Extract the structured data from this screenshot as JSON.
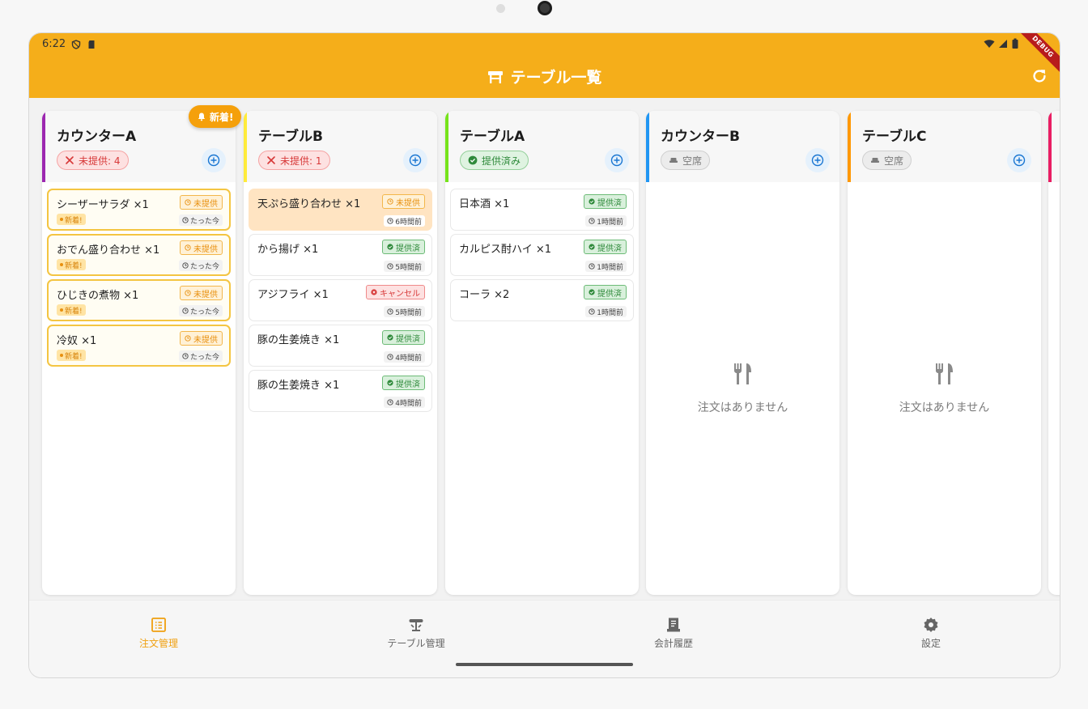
{
  "status_bar": {
    "time": "6:22",
    "debug_label": "DEBUG"
  },
  "app_bar": {
    "title": "テーブル一覧",
    "refresh_icon": "refresh-icon"
  },
  "columns": [
    {
      "name": "カウンターA",
      "accent": "#9c27b0",
      "status": "未提供: 4",
      "status_kind": "red",
      "new_badge": "新着!",
      "orders": [
        {
          "name": "シーザーサラダ ×1",
          "status": "未提供",
          "status_kind": "pending",
          "time": "たった今",
          "tag": "新着!"
        },
        {
          "name": "おでん盛り合わせ ×1",
          "status": "未提供",
          "status_kind": "pending",
          "time": "たった今",
          "tag": "新着!"
        },
        {
          "name": "ひじきの煮物 ×1",
          "status": "未提供",
          "status_kind": "pending",
          "time": "たった今",
          "tag": "新着!"
        },
        {
          "name": "冷奴 ×1",
          "status": "未提供",
          "status_kind": "pending",
          "time": "たった今",
          "tag": "新着!"
        }
      ]
    },
    {
      "name": "テーブルB",
      "accent": "#ffeb3b",
      "status": "未提供: 1",
      "status_kind": "red",
      "orders": [
        {
          "name": "天ぷら盛り合わせ ×1",
          "status": "未提供",
          "status_kind": "pending",
          "time": "6時間前",
          "highlight": true
        },
        {
          "name": "から揚げ ×1",
          "status": "提供済",
          "status_kind": "done",
          "time": "5時間前"
        },
        {
          "name": "アジフライ ×1",
          "status": "キャンセル",
          "status_kind": "cancel",
          "time": "5時間前"
        },
        {
          "name": "豚の生姜焼き ×1",
          "status": "提供済",
          "status_kind": "done",
          "time": "4時間前"
        },
        {
          "name": "豚の生姜焼き ×1",
          "status": "提供済",
          "status_kind": "done",
          "time": "4時間前"
        }
      ]
    },
    {
      "name": "テーブルA",
      "accent": "#76e31a",
      "status": "提供済み",
      "status_kind": "green",
      "orders": [
        {
          "name": "日本酒 ×1",
          "status": "提供済",
          "status_kind": "done",
          "time": "1時間前"
        },
        {
          "name": "カルピス酎ハイ ×1",
          "status": "提供済",
          "status_kind": "done",
          "time": "1時間前"
        },
        {
          "name": "コーラ ×2",
          "status": "提供済",
          "status_kind": "done",
          "time": "1時間前"
        }
      ]
    },
    {
      "name": "カウンターB",
      "accent": "#2196f3",
      "status": "空席",
      "status_kind": "gray",
      "orders": [],
      "empty_text": "注文はありません"
    },
    {
      "name": "テーブルC",
      "accent": "#ff9800",
      "status": "空席",
      "status_kind": "gray",
      "orders": [],
      "empty_text": "注文はありません"
    },
    {
      "name": "",
      "accent": "#e91e63",
      "status": "",
      "status_kind": "gray",
      "orders": []
    }
  ],
  "nav": [
    {
      "label": "注文管理",
      "icon": "order-list-icon",
      "active": true
    },
    {
      "label": "テーブル管理",
      "icon": "table-icon",
      "active": false
    },
    {
      "label": "会計履歴",
      "icon": "receipt-icon",
      "active": false
    },
    {
      "label": "設定",
      "icon": "gear-icon",
      "active": false
    }
  ],
  "colors": {
    "app_bar": "#f5ae1a",
    "active_nav": "#f0a010",
    "pending": "#e8900f",
    "done": "#2f8a3b",
    "cancel": "#d73838"
  }
}
